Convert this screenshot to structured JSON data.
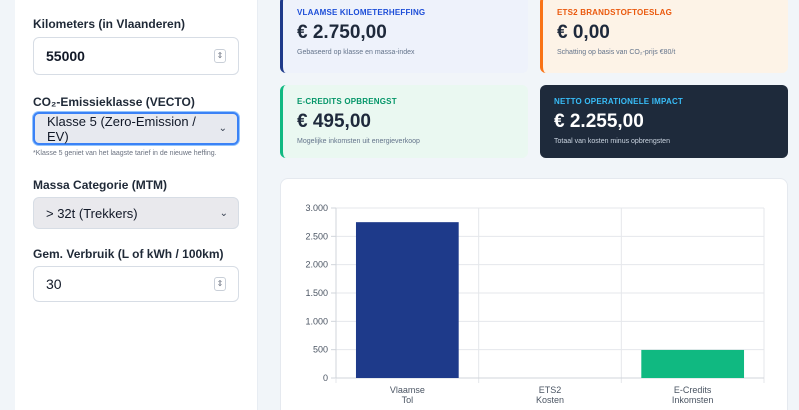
{
  "sidebar": {
    "km_label": "Kilometers (in Vlaanderen)",
    "km_value": "55000",
    "emission_label": "CO₂-Emissieklasse (VECTO)",
    "emission_selected": "Klasse 5 (Zero-Emission / EV)",
    "emission_hint": "*Klasse 5 geniet van het laagste tarief in de nieuwe heffing.",
    "mass_label": "Massa Categorie (MTM)",
    "mass_selected": "> 32t (Trekkers)",
    "usage_label": "Gem. Verbruik (L of kWh / 100km)",
    "usage_value": "30"
  },
  "cards": {
    "toll": {
      "title": "VLAAMSE KILOMETERHEFFING",
      "value": "€ 2.750,00",
      "sub": "Gebaseerd op klasse en massa-index"
    },
    "ets2": {
      "title": "ETS2 BRANDSTOFTOESLAG",
      "value": "€ 0,00",
      "sub": "Schatting op basis van CO₂-prijs €80/t"
    },
    "ecredits": {
      "title": "E-CREDITS OPBRENGST",
      "value": "€ 495,00",
      "sub": "Mogelijke inkomsten uit energieverkoop"
    },
    "net": {
      "title": "NETTO OPERATIONELE IMPACT",
      "value": "€ 2.255,00",
      "sub": "Totaal van kosten minus opbrengsten"
    }
  },
  "colors": {
    "toll": "#1e3a8a",
    "ets2": "#f97316",
    "ecredits": "#10b981",
    "net_bg": "#1e2a3b"
  },
  "chart_data": {
    "type": "bar",
    "categories": [
      [
        "Vlaamse",
        "Tol"
      ],
      [
        "ETS2",
        "Kosten"
      ],
      [
        "E-Credits",
        "Inkomsten"
      ]
    ],
    "values": [
      2750,
      0,
      495
    ],
    "colors": [
      "#1e3a8a",
      "#f97316",
      "#10b981"
    ],
    "ylim": [
      0,
      3000
    ],
    "yticks": [
      0,
      500,
      1000,
      1500,
      2000,
      2500,
      3000
    ],
    "ytick_labels": [
      "0",
      "500",
      "1.000",
      "1.500",
      "2.000",
      "2.500",
      "3.000"
    ],
    "grid": true
  }
}
